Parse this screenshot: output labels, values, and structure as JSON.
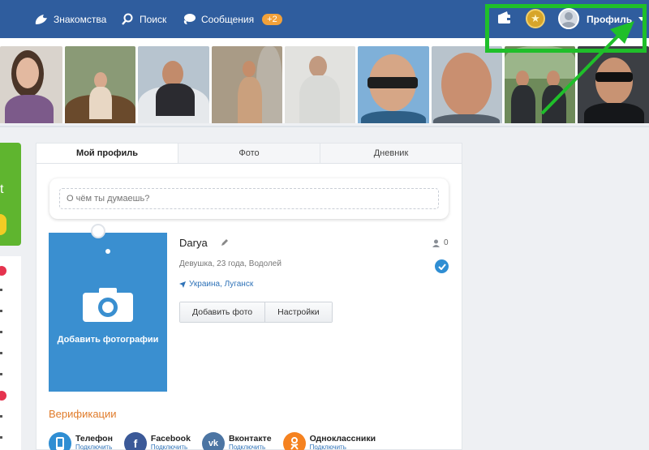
{
  "topbar": {
    "nav": [
      {
        "label": "Знакомства",
        "icon": "dating-icon"
      },
      {
        "label": "Поиск",
        "icon": "search-icon"
      },
      {
        "label": "Сообщения",
        "icon": "messages-icon",
        "badge": "+2"
      }
    ],
    "profile_label": "Профиль",
    "colors": {
      "bar": "#2f5d9e",
      "badge": "#f2a13a",
      "highlight": "#1fbf2a"
    }
  },
  "photo_strip": {
    "count": 9
  },
  "profile_card": {
    "tabs": [
      "Мой профиль",
      "Фото",
      "Дневник"
    ],
    "status_placeholder": "О чём ты думаешь?",
    "add_photo_label": "Добавить фотографии",
    "name": "Darya",
    "friends_count": "0",
    "meta": "Девушка, 23 года, Водолей",
    "location": "Украина, Луганск",
    "buttons": {
      "add_photo": "Добавить фото",
      "settings": "Настройки"
    },
    "verification_title": "Верификации",
    "verifications": [
      {
        "label": "Телефон",
        "sub": "Подключить",
        "icon": "phone-icon",
        "color": "#2f8ed3"
      },
      {
        "label": "Facebook",
        "sub": "Подключить",
        "icon": "facebook-icon",
        "color": "#3b5998"
      },
      {
        "label": "Вконтакте",
        "sub": "Подключить",
        "icon": "vk-icon",
        "color": "#4c75a3"
      },
      {
        "label": "Одноклассники",
        "sub": "Подключить",
        "icon": "ok-icon",
        "color": "#f58220"
      }
    ]
  }
}
